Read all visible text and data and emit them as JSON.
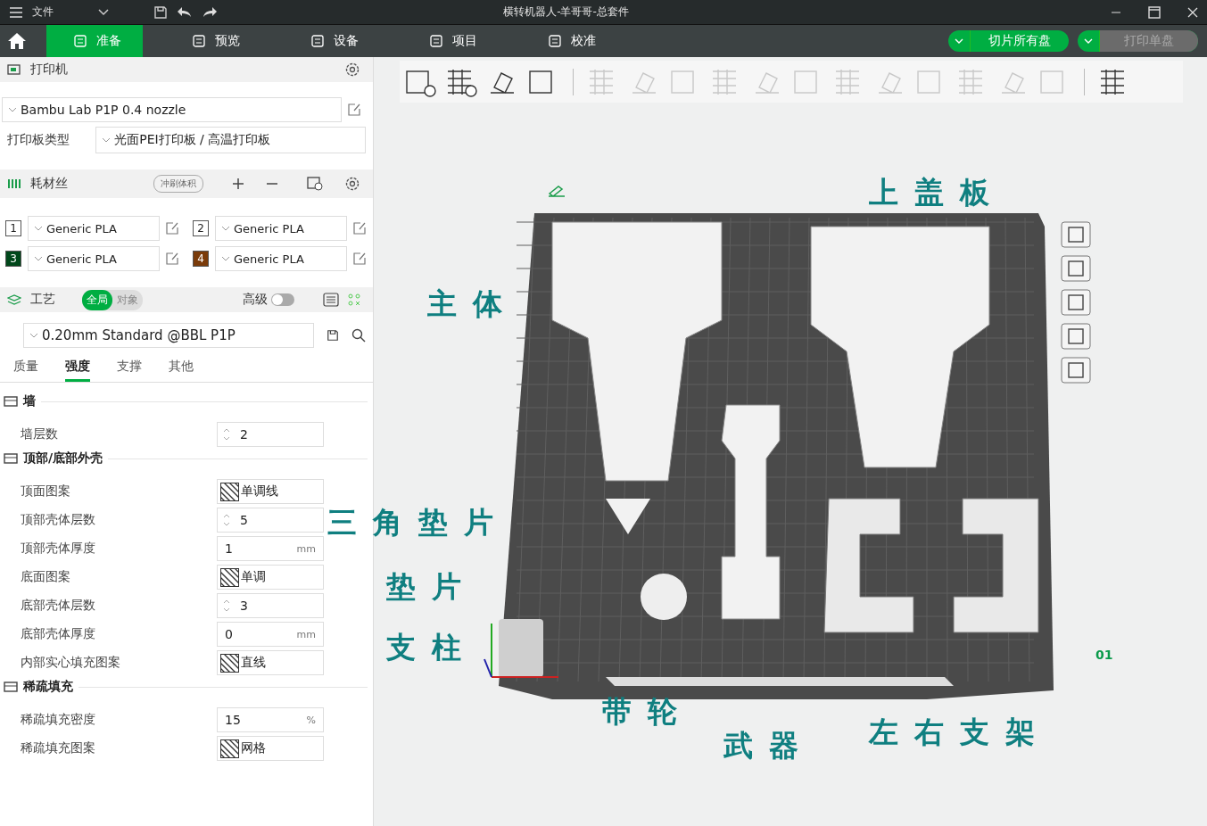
{
  "window": {
    "menu": "文件",
    "title": "横转机器人-羊哥哥-总套件"
  },
  "nav_tabs": [
    {
      "label": "准备",
      "selected": true
    },
    {
      "label": "预览",
      "selected": false
    },
    {
      "label": "设备",
      "selected": false
    },
    {
      "label": "项目",
      "selected": false
    },
    {
      "label": "校准",
      "selected": false
    }
  ],
  "actions": [
    {
      "label": "切片所有盘",
      "disabled": false
    },
    {
      "label": "打印单盘",
      "disabled": true
    }
  ],
  "printer": {
    "title": "打印机",
    "preset": "Bambu Lab P1P 0.4 nozzle",
    "plate_label": "打印板类型",
    "plate": "光面PEI打印板 / 高温打印板"
  },
  "filament": {
    "title": "耗材丝",
    "flush_button": "冲刷体积",
    "slots": [
      {
        "number": "1",
        "color": "#ffffff",
        "name": "Generic PLA"
      },
      {
        "number": "2",
        "color": "#ffffff",
        "name": "Generic PLA"
      },
      {
        "number": "3",
        "color": "#00471a",
        "name": "Generic PLA"
      },
      {
        "number": "4",
        "color": "#7a3b0a",
        "name": "Generic PLA"
      }
    ]
  },
  "process": {
    "title": "工艺",
    "scope": [
      {
        "label": "全局",
        "selected": true
      },
      {
        "label": "对象",
        "selected": false
      }
    ],
    "advanced_label": "高级",
    "advanced_on": false,
    "preset": "0.20mm Standard @BBL P1P",
    "tabs": [
      {
        "label": "质量",
        "selected": false
      },
      {
        "label": "强度",
        "selected": true
      },
      {
        "label": "支撑",
        "selected": false
      },
      {
        "label": "其他",
        "selected": false
      }
    ],
    "sections": [
      {
        "title": "墙",
        "rows": [
          {
            "label": "墙层数",
            "kind": "spin",
            "value": "2"
          }
        ]
      },
      {
        "title": "顶部/底部外壳",
        "rows": [
          {
            "label": "顶面图案",
            "kind": "pattern",
            "value": "单调线"
          },
          {
            "label": "顶部壳体层数",
            "kind": "spin",
            "value": "5"
          },
          {
            "label": "顶部壳体厚度",
            "kind": "unit",
            "value": "1",
            "unit": "mm"
          },
          {
            "label": "底面图案",
            "kind": "pattern",
            "value": "单调"
          },
          {
            "label": "底部壳体层数",
            "kind": "spin",
            "value": "3"
          },
          {
            "label": "底部壳体厚度",
            "kind": "unit",
            "value": "0",
            "unit": "mm"
          },
          {
            "label": "内部实心填充图案",
            "kind": "pattern",
            "value": "直线"
          }
        ]
      },
      {
        "title": "稀疏填充",
        "rows": [
          {
            "label": "稀疏填充密度",
            "kind": "unit",
            "value": "15",
            "unit": "%"
          },
          {
            "label": "稀疏填充图案",
            "kind": "pattern",
            "value": "网格"
          }
        ]
      }
    ]
  },
  "toolbar": [
    {
      "disabled": false
    },
    {
      "disabled": false
    },
    {
      "disabled": false
    },
    {
      "disabled": false
    },
    {
      "disabled": true
    },
    {
      "disabled": true
    },
    {
      "disabled": true
    },
    {
      "disabled": true
    },
    {
      "disabled": true
    },
    {
      "disabled": true
    },
    {
      "disabled": true
    },
    {
      "disabled": true
    },
    {
      "disabled": true
    },
    {
      "disabled": true
    },
    {
      "disabled": true
    },
    {
      "disabled": true
    },
    {
      "disabled": false
    }
  ],
  "viewport": {
    "plate_number": "01",
    "annotations": [
      "上盖板",
      "主体",
      "三角垫片",
      "垫片",
      "支柱",
      "带轮",
      "武器",
      "左右支架"
    ]
  }
}
